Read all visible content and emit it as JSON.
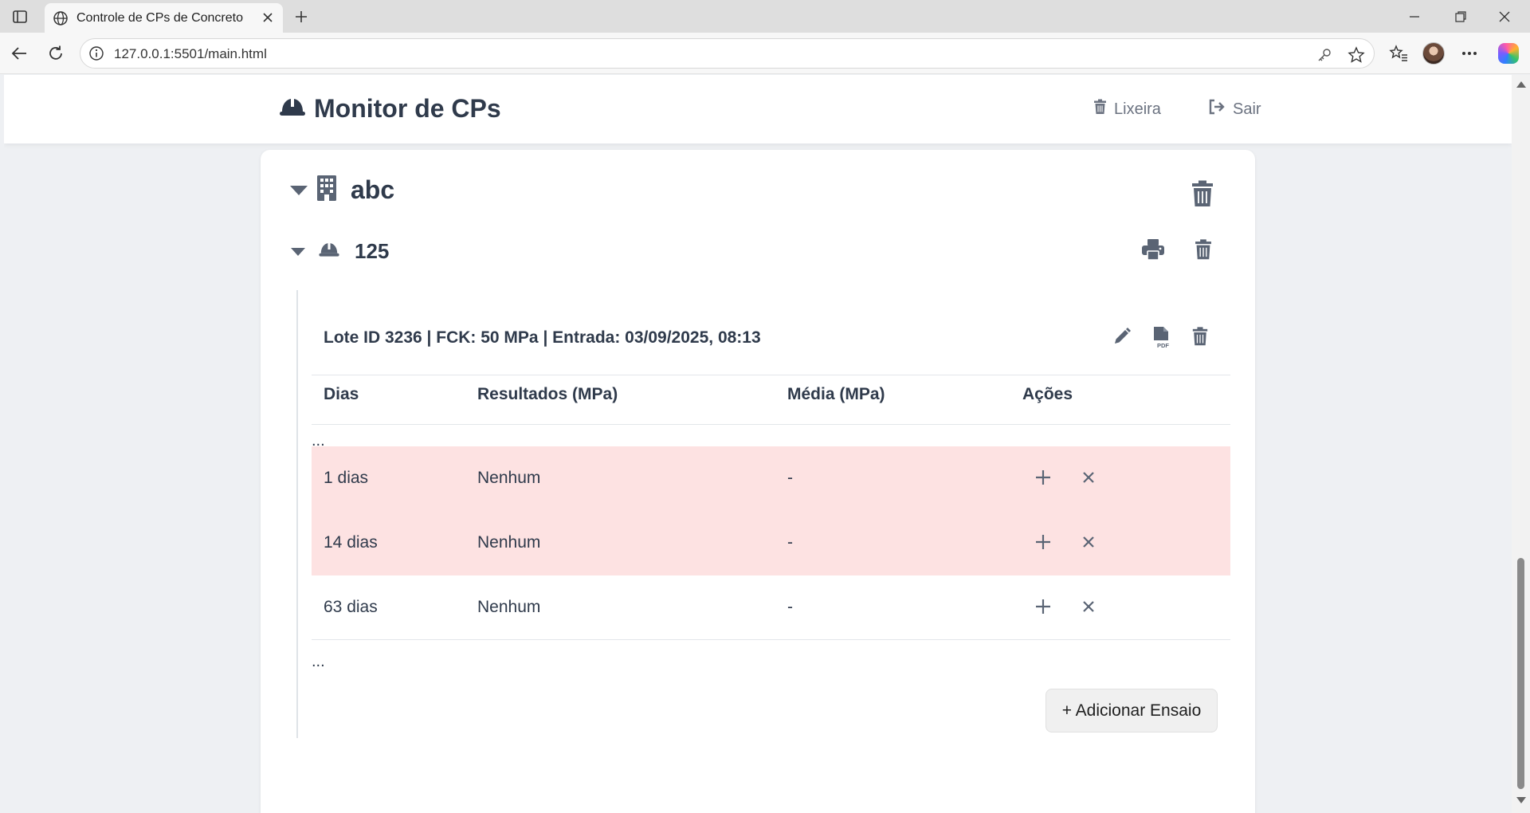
{
  "browser": {
    "tab_title": "Controle de CPs de Concreto",
    "url": "127.0.0.1:5501/main.html"
  },
  "header": {
    "brand_icon": "hard-hat-icon",
    "title": "Monitor de CPs",
    "trash_label": "Lixeira",
    "logout_label": "Sair"
  },
  "obra": {
    "icon": "building-icon",
    "name": "abc"
  },
  "cp": {
    "icon": "hard-hat-icon",
    "name": "125"
  },
  "lote": {
    "title": "Lote ID 3236 | FCK: 50 MPa | Entrada: 03/09/2025, 08:13",
    "columns": {
      "dias": "Dias",
      "resultados": "Resultados (MPa)",
      "media": "Média (MPa)",
      "acoes": "Ações"
    },
    "ellipsis_top": "...",
    "ellipsis_bottom": "...",
    "rows": [
      {
        "dias": "1 dias",
        "resultados": "Nenhum",
        "media": "-",
        "overdue": true
      },
      {
        "dias": "14 dias",
        "resultados": "Nenhum",
        "media": "-",
        "overdue": true
      },
      {
        "dias": "63 dias",
        "resultados": "Nenhum",
        "media": "-",
        "overdue": false
      }
    ],
    "add_button_label": "+ Adicionar Ensaio"
  },
  "colors": {
    "text": "#2f3a4b",
    "muted": "#6b7280",
    "overdue_row": "#fde2e2",
    "page_bg": "#eef0f3"
  }
}
